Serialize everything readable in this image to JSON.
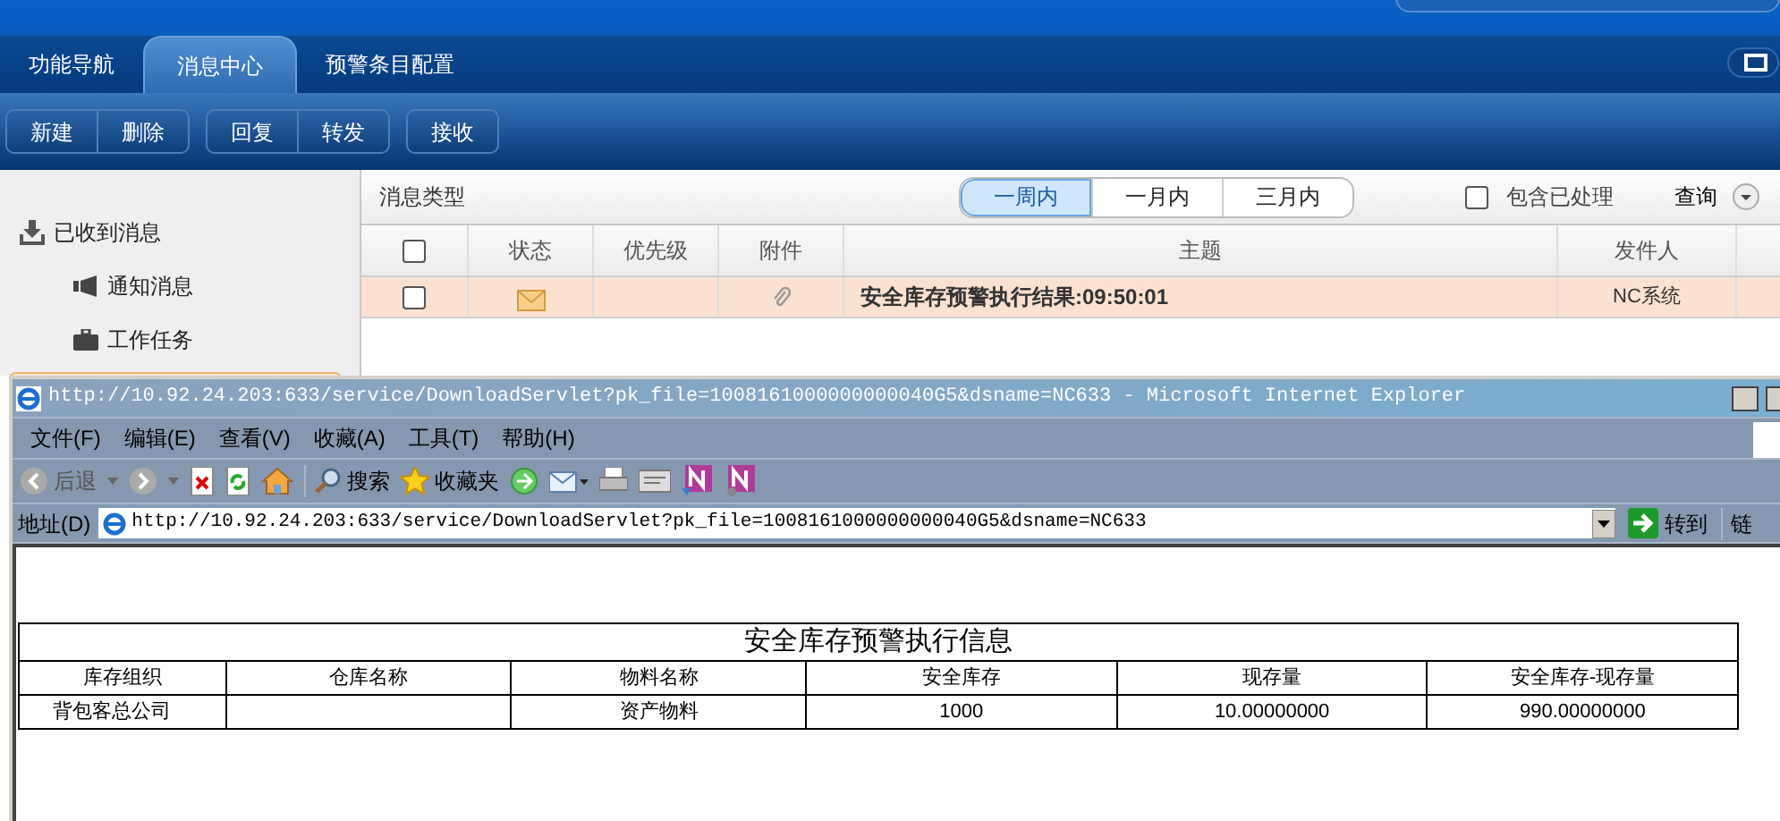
{
  "app": {
    "tabs": [
      {
        "label": "功能导航",
        "selected": false
      },
      {
        "label": "消息中心",
        "selected": true
      },
      {
        "label": "预警条目配置",
        "selected": false
      }
    ],
    "toolbar_groups": [
      [
        "新建",
        "删除"
      ],
      [
        "回复",
        "转发"
      ],
      [
        "接收"
      ]
    ],
    "sidebar": [
      {
        "label": "已收到消息",
        "selected": false,
        "children": [
          {
            "label": "通知消息",
            "selected": false
          },
          {
            "label": "工作任务",
            "selected": false
          },
          {
            "selected": true
          }
        ]
      }
    ],
    "filter": {
      "label": "消息类型",
      "periods": [
        {
          "label": "一周内",
          "selected": true
        },
        {
          "label": "一月内",
          "selected": false
        },
        {
          "label": "三月内",
          "selected": false
        }
      ],
      "include_processed": {
        "label": "包含已处理",
        "checked": false
      },
      "query": "查询"
    },
    "messages": {
      "header_checked": false,
      "columns": [
        "状态",
        "优先级",
        "附件",
        "主题",
        "发件人"
      ],
      "rows": [
        {
          "selected": true,
          "checked": false,
          "unread": true,
          "attachment": true,
          "subject": "安全库存预警执行结果:09:50:01",
          "sender": "NC系统"
        }
      ]
    }
  },
  "browser": {
    "title": "http://10.92.24.203:633/service/DownloadServlet?pk_file=1008161000000000040G5&dsname=NC633 - Microsoft Internet Explorer",
    "menu": [
      "文件(F)",
      "编辑(E)",
      "查看(V)",
      "收藏(A)",
      "工具(T)",
      "帮助(H)"
    ],
    "back": "后退",
    "search": "搜索",
    "favorites": "收藏夹",
    "address_label": "地址(D)",
    "address": "http://10.92.24.203:633/service/DownloadServlet?pk_file=1008161000000000040G5&dsname=NC633",
    "go": "转到",
    "links": "链"
  },
  "document": {
    "title": "安全库存预警执行信息",
    "columns": [
      "库存组织",
      "仓库名称",
      "物料名称",
      "安全库存",
      "现存量",
      "安全库存-现存量"
    ],
    "rows": [
      [
        "背包客总公司",
        "",
        "资产物料",
        "1000",
        "10.00000000",
        "990.00000000"
      ]
    ]
  }
}
